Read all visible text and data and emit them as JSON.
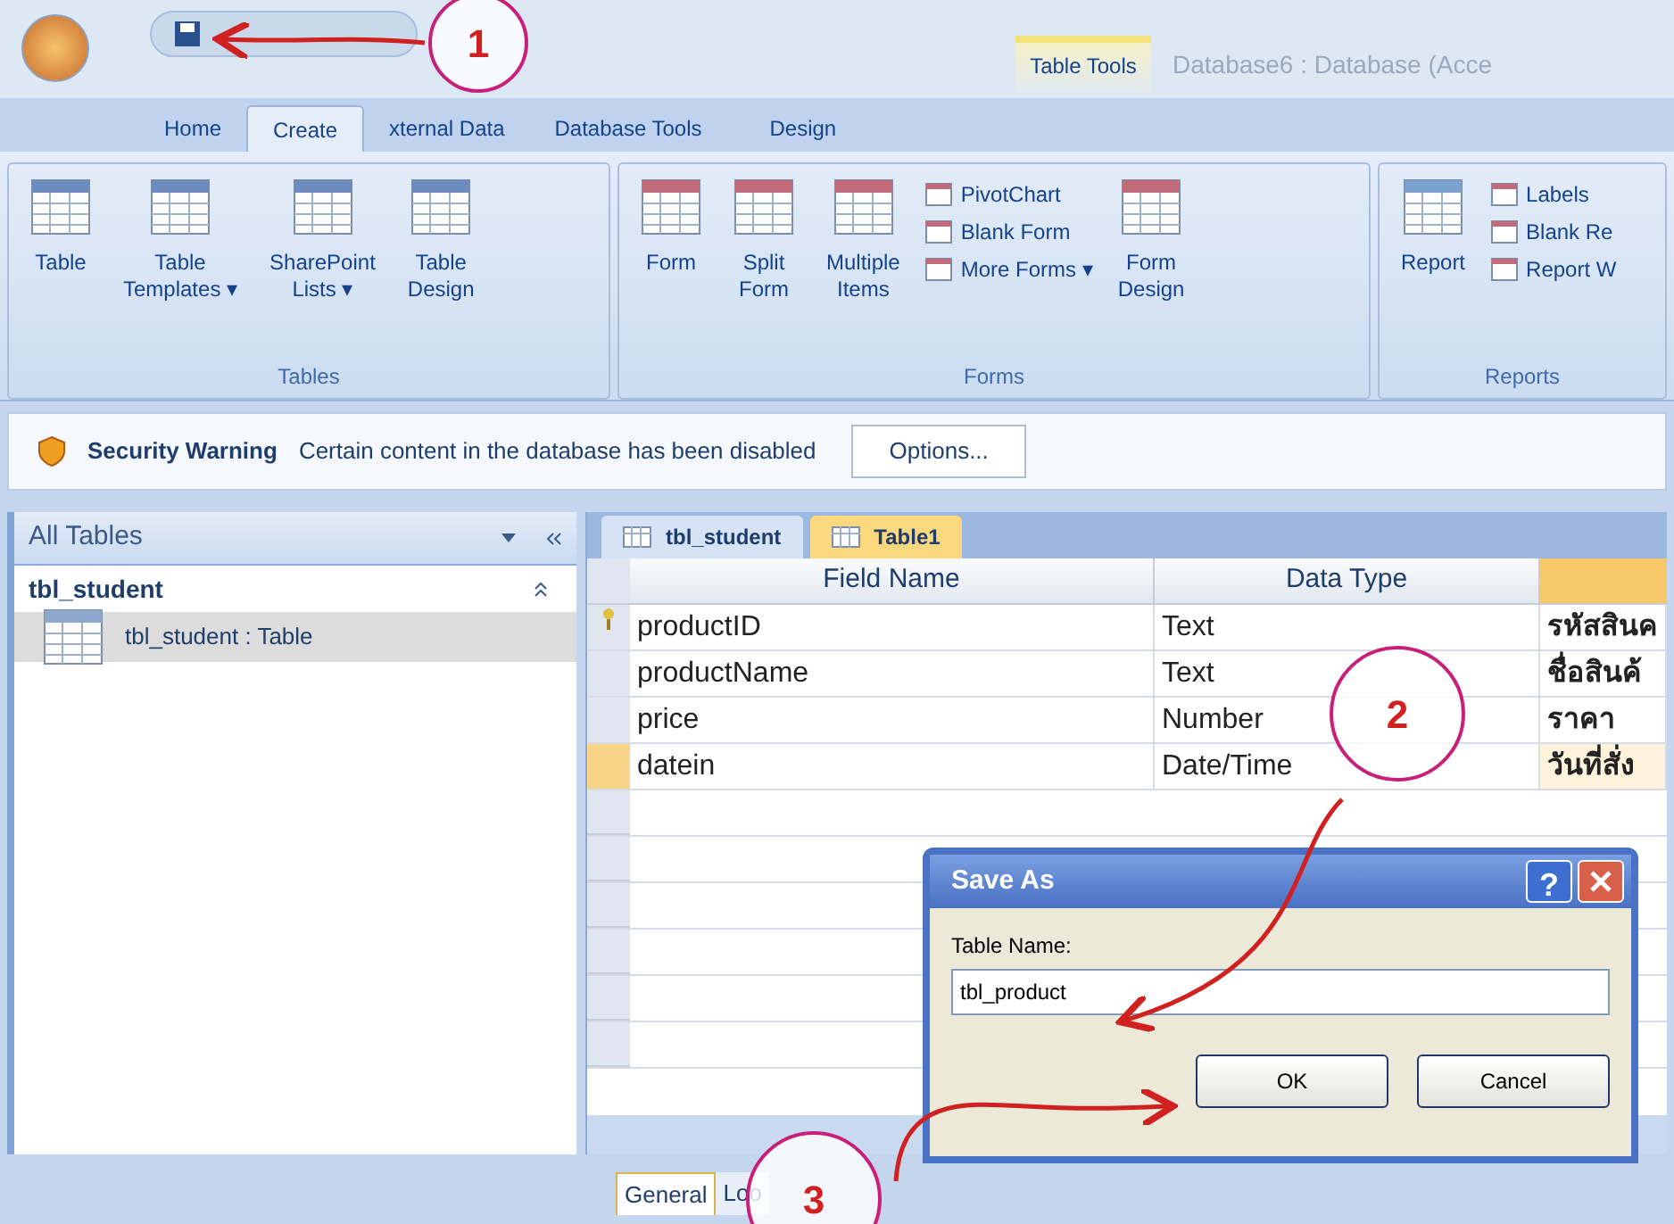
{
  "title_bar": {
    "contextual_tab": "Table Tools",
    "title": "Database6 : Database (Acce"
  },
  "tabs": [
    {
      "label": "Home",
      "selected": false
    },
    {
      "label": "Create",
      "selected": true
    },
    {
      "label": "xternal Data",
      "selected": false
    },
    {
      "label": "Database Tools",
      "selected": false
    },
    {
      "label": "Design",
      "selected": false
    }
  ],
  "ribbon": {
    "groups": [
      {
        "label": "Tables",
        "items": [
          {
            "kind": "large",
            "lines": [
              "Table"
            ]
          },
          {
            "kind": "large",
            "lines": [
              "Table",
              "Templates ▾"
            ]
          },
          {
            "kind": "large",
            "lines": [
              "SharePoint",
              "Lists ▾"
            ]
          },
          {
            "kind": "large",
            "lines": [
              "Table",
              "Design"
            ]
          }
        ]
      },
      {
        "label": "Forms",
        "items": [
          {
            "kind": "large",
            "lines": [
              "Form"
            ]
          },
          {
            "kind": "large",
            "lines": [
              "Split",
              "Form"
            ]
          },
          {
            "kind": "large",
            "lines": [
              "Multiple",
              "Items"
            ]
          },
          {
            "kind": "stack",
            "entries": [
              "PivotChart",
              "Blank Form",
              "More Forms ▾"
            ]
          },
          {
            "kind": "large",
            "lines": [
              "Form",
              "Design"
            ]
          }
        ]
      },
      {
        "label": "Reports",
        "items": [
          {
            "kind": "large",
            "lines": [
              "Report"
            ]
          },
          {
            "kind": "stack",
            "entries": [
              "Labels",
              "Blank Re",
              "Report W"
            ]
          }
        ]
      }
    ]
  },
  "security_bar": {
    "title": "Security Warning",
    "message": "Certain content in the database has been disabled",
    "button": "Options..."
  },
  "navigation": {
    "header": "All Tables",
    "group": "tbl_student",
    "items": [
      {
        "label": "tbl_student : Table",
        "selected": true
      }
    ]
  },
  "document_tabs": [
    {
      "label": "tbl_student",
      "selected": false
    },
    {
      "label": "Table1",
      "selected": true
    }
  ],
  "table": {
    "columns": [
      "Field Name",
      "Data Type"
    ],
    "rows": [
      {
        "primary_key": true,
        "selected": false,
        "cells": [
          "productID",
          "Text",
          "รหัสสินค"
        ]
      },
      {
        "primary_key": false,
        "selected": false,
        "cells": [
          "productName",
          "Text",
          "ชื่อสินค้"
        ]
      },
      {
        "primary_key": false,
        "selected": false,
        "cells": [
          "price",
          "Number",
          "ราคา"
        ]
      },
      {
        "primary_key": false,
        "selected": true,
        "cells": [
          "datein",
          "Date/Time",
          "วันที่สั่ง"
        ]
      }
    ]
  },
  "property_tabs": [
    {
      "label": "General",
      "selected": true
    },
    {
      "label": "Loo",
      "selected": false
    }
  ],
  "dialog": {
    "title": "Save As",
    "help": "?",
    "field_label": "Table Name:",
    "value": "tbl_product",
    "buttons": [
      "OK",
      "Cancel"
    ]
  },
  "annotations": [
    "1",
    "2",
    "3"
  ]
}
